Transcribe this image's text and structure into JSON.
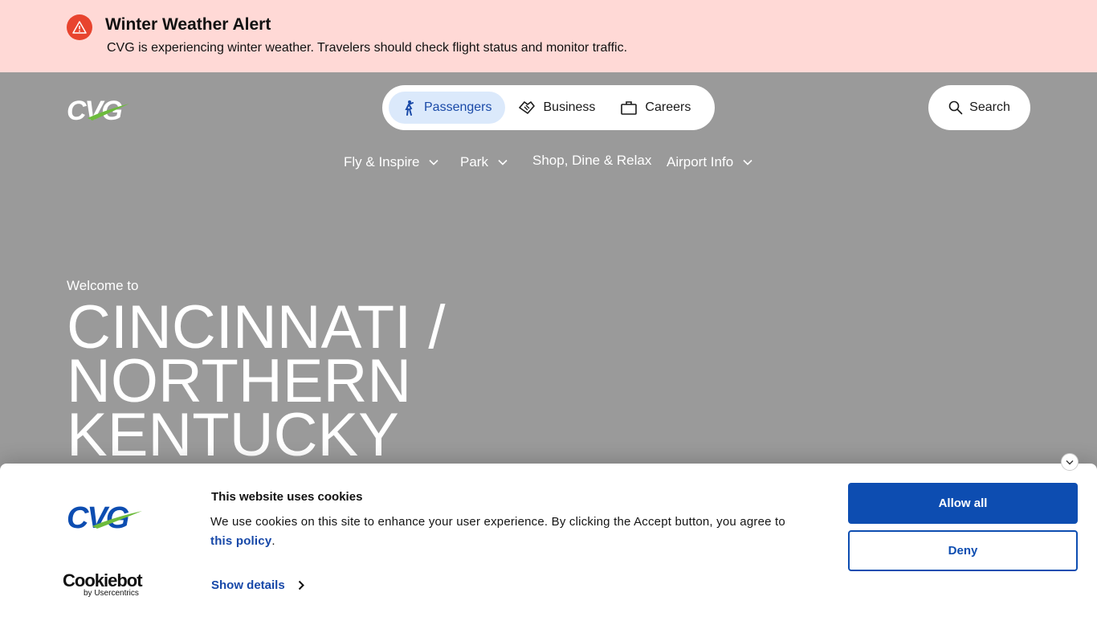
{
  "alert": {
    "title": "Winter Weather Alert",
    "message": "CVG is experiencing winter weather. Travelers should check flight status and monitor traffic."
  },
  "header": {
    "logo_text": "CVG",
    "segments": [
      {
        "label": "Passengers",
        "icon": "person-walking-icon",
        "active": true
      },
      {
        "label": "Business",
        "icon": "handshake-icon",
        "active": false
      },
      {
        "label": "Careers",
        "icon": "briefcase-icon",
        "active": false
      }
    ],
    "search_label": "Search"
  },
  "nav": {
    "items": [
      {
        "label": "Fly & Inspire",
        "has_dropdown": true
      },
      {
        "label": "Park",
        "has_dropdown": true
      },
      {
        "label": "Shop, Dine & Relax",
        "has_dropdown": false
      },
      {
        "label": "Airport Info",
        "has_dropdown": true
      }
    ]
  },
  "hero": {
    "welcome": "Welcome to",
    "title_lines": [
      "CINCINNATI /",
      "NORTHERN",
      "KENTUCKY"
    ]
  },
  "cookie": {
    "title": "This website uses cookies",
    "text_before_link": "We use cookies on this site to enhance your user experience. By clicking the Accept button, you agree to ",
    "link_text": "this policy",
    "text_after_link": ".",
    "show_details": "Show details",
    "allow_all": "Allow all",
    "deny": "Deny",
    "provider_main": "Cookiebot",
    "provider_sub": "by Usercentrics"
  },
  "colors": {
    "alert_bg": "#ffd9d6",
    "alert_icon": "#e8442e",
    "hero_bg": "#9a9a9a",
    "brand_blue": "#0d4db1",
    "brand_green": "#6dbb3c"
  }
}
